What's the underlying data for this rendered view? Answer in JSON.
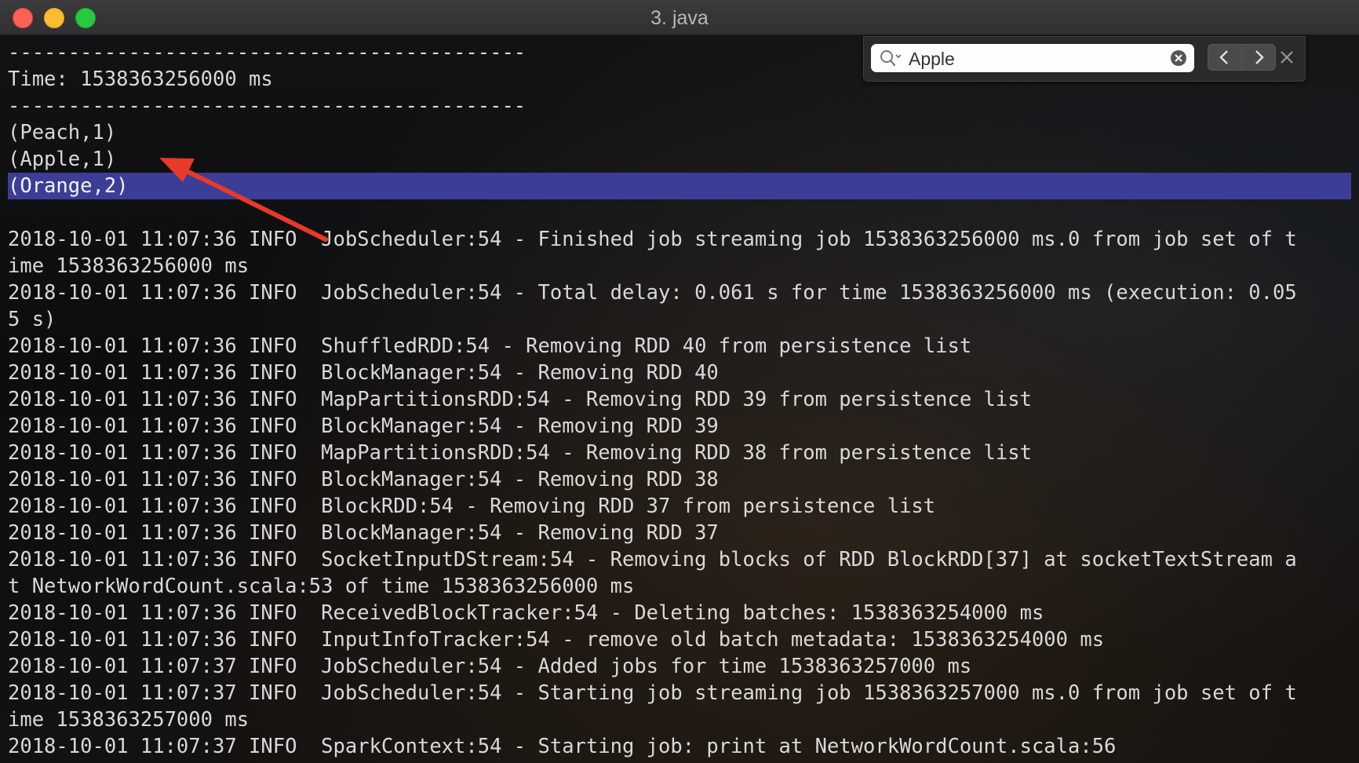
{
  "window": {
    "title": "3. java"
  },
  "find": {
    "query": "Apple"
  },
  "terminal": {
    "lines": [
      "-------------------------------------------",
      "Time: 1538363256000 ms",
      "-------------------------------------------",
      "(Peach,1)",
      "(Apple,1)",
      "(Orange,2)",
      "",
      "2018-10-01 11:07:36 INFO  JobScheduler:54 - Finished job streaming job 1538363256000 ms.0 from job set of t",
      "ime 1538363256000 ms",
      "2018-10-01 11:07:36 INFO  JobScheduler:54 - Total delay: 0.061 s for time 1538363256000 ms (execution: 0.05",
      "5 s)",
      "2018-10-01 11:07:36 INFO  ShuffledRDD:54 - Removing RDD 40 from persistence list",
      "2018-10-01 11:07:36 INFO  BlockManager:54 - Removing RDD 40",
      "2018-10-01 11:07:36 INFO  MapPartitionsRDD:54 - Removing RDD 39 from persistence list",
      "2018-10-01 11:07:36 INFO  BlockManager:54 - Removing RDD 39",
      "2018-10-01 11:07:36 INFO  MapPartitionsRDD:54 - Removing RDD 38 from persistence list",
      "2018-10-01 11:07:36 INFO  BlockManager:54 - Removing RDD 38",
      "2018-10-01 11:07:36 INFO  BlockRDD:54 - Removing RDD 37 from persistence list",
      "2018-10-01 11:07:36 INFO  BlockManager:54 - Removing RDD 37",
      "2018-10-01 11:07:36 INFO  SocketInputDStream:54 - Removing blocks of RDD BlockRDD[37] at socketTextStream a",
      "t NetworkWordCount.scala:53 of time 1538363256000 ms",
      "2018-10-01 11:07:36 INFO  ReceivedBlockTracker:54 - Deleting batches: 1538363254000 ms",
      "2018-10-01 11:07:36 INFO  InputInfoTracker:54 - remove old batch metadata: 1538363254000 ms",
      "2018-10-01 11:07:37 INFO  JobScheduler:54 - Added jobs for time 1538363257000 ms",
      "2018-10-01 11:07:37 INFO  JobScheduler:54 - Starting job streaming job 1538363257000 ms.0 from job set of t",
      "ime 1538363257000 ms",
      "2018-10-01 11:07:37 INFO  SparkContext:54 - Starting job: print at NetworkWordCount.scala:56"
    ]
  },
  "colors": {
    "highlight": "#3c3d96",
    "arrow": "#e8392a",
    "text": "#d8d8d8"
  }
}
